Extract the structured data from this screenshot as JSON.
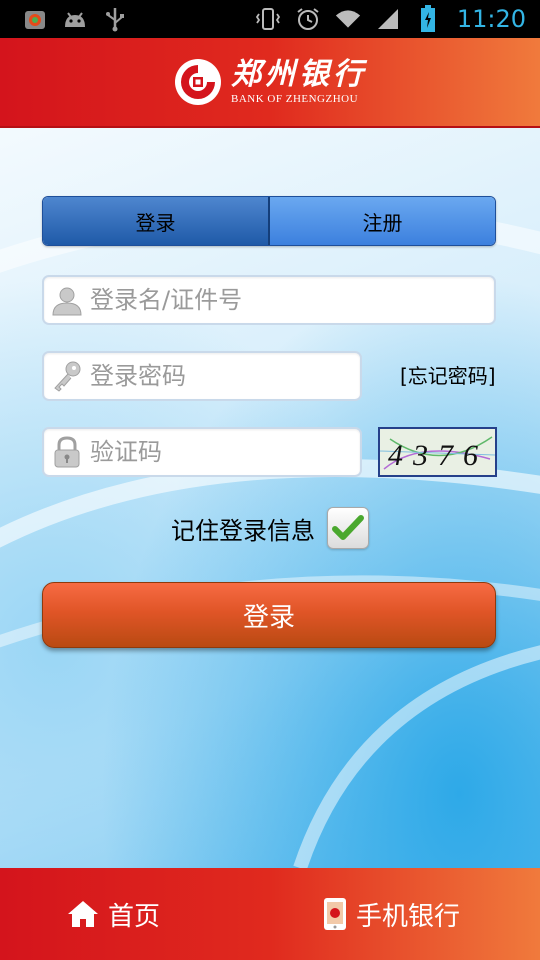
{
  "status_bar": {
    "time": "11:20",
    "icons": [
      "app-icon",
      "android-icon",
      "usb-icon",
      "vibrate-icon",
      "alarm-icon",
      "wifi-icon",
      "signal-icon",
      "battery-icon"
    ]
  },
  "header": {
    "brand_cn": "郑州银行",
    "brand_en": "BANK OF ZHENGZHOU"
  },
  "tabs": [
    {
      "label": "登录",
      "active": true
    },
    {
      "label": "注册",
      "active": false
    }
  ],
  "form": {
    "username_placeholder": "登录名/证件号",
    "password_placeholder": "登录密码",
    "forgot_password": "[忘记密码]",
    "captcha_placeholder": "验证码",
    "captcha_text": "4376",
    "remember_label": "记住登录信息",
    "remember_checked": true,
    "login_button": "登录"
  },
  "bottom_nav": [
    {
      "label": "首页",
      "icon": "home-icon"
    },
    {
      "label": "手机银行",
      "icon": "mobile-icon"
    }
  ],
  "colors": {
    "brand_red": "#d4141c",
    "brand_orange": "#f07a3c",
    "tab_active": "#1f5aa8",
    "tab_inactive": "#3c80de",
    "button": "#e05527",
    "status_blue": "#33b5e5"
  }
}
